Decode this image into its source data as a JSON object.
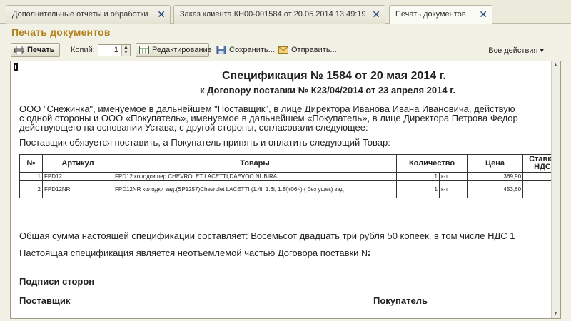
{
  "tabs": [
    {
      "label": "Дополнительные отчеты и обработки",
      "close": "✕"
    },
    {
      "label": "Заказ клиента КН00-001584 от 20.05.2014 13:49:19",
      "close": "✕"
    },
    {
      "label": "Печать документов",
      "close": "✕"
    }
  ],
  "page_title": "Печать документов",
  "toolbar": {
    "print_label": "Печать",
    "copies_label": "Копий:",
    "copies_value": "1",
    "edit_label": "Редактирование",
    "save_label": "Сохранить...",
    "send_label": "Отправить...",
    "all_actions_label": "Все действия ▾"
  },
  "doc": {
    "heading": "Спецификация № 1584 от 20 мая 2014 г.",
    "subheading": "к Договору поставки № К23/04/2014 от 23 апреля 2014 г.",
    "intro_lines": [
      "ООО \"Снежинка\", именуемое в дальнейшем \"Поставщик\", в лице Директора Иванова Ивана Ивановича, действую",
      "с одной стороны и ООО «Покупатель», именуемое в дальнейшем «Покупатель», в лице Директора Петрова Федор",
      "действующего на основании Устава, с другой стороны, согласовали следующее:"
    ],
    "obligation": "Поставщик обязуется поставить, а Покупатель принять и оплатить следующий Товар:",
    "table": {
      "headers": [
        "№",
        "Артикул",
        "Товары",
        "Количество",
        "",
        "Цена",
        "Ставка НДС"
      ],
      "rows": [
        {
          "n": "1",
          "article": "FPD12",
          "goods": "FPD12 колодки пер.CHEVROLET LACETTI,DAEVOO NUBIRA",
          "qty": "1",
          "unit": "к-т",
          "price": "369,90"
        },
        {
          "n": "2",
          "article": "FPD12NR",
          "goods": "FPD12NR колодки зад.(SP1257)Chevrolet LACETTI (1.4i, 1.6i, 1.8i)(06~) ( без ушек) зад",
          "qty": "1",
          "unit": "к-т",
          "price": "453,60"
        }
      ]
    },
    "total": "Общая сумма настоящей спецификации составляет: Восемьсот двадцать три рубля 50 копеек, в том числе НДС 1",
    "integral": "Настоящая спецификация является неотъемлемой частью Договора поставки №",
    "signatures_title": "Подписи сторон",
    "supplier_label": "Поставщик",
    "buyer_label": "Покупатель"
  },
  "colors": {
    "title": "#b3801a",
    "close_icon": "#1c3f7a"
  }
}
